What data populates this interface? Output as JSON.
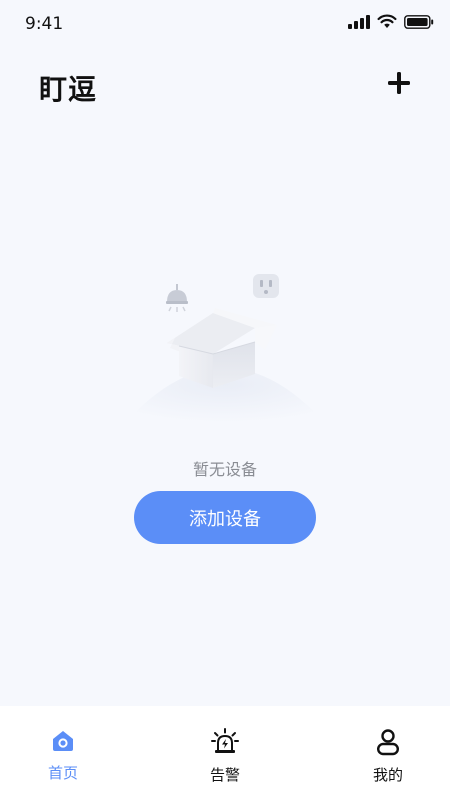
{
  "status_bar": {
    "time": "9:41"
  },
  "header": {
    "title": "盯逗"
  },
  "empty_state": {
    "message": "暂无设备",
    "add_button_label": "添加设备"
  },
  "tab_bar": {
    "items": [
      {
        "label": "首页",
        "icon": "home-icon",
        "active": true
      },
      {
        "label": "告警",
        "icon": "alarm-icon",
        "active": false
      },
      {
        "label": "我的",
        "icon": "user-icon",
        "active": false
      }
    ]
  },
  "colors": {
    "accent": "#5b8ef7",
    "background": "#f6f8fd",
    "inactive_text": "#111111"
  }
}
